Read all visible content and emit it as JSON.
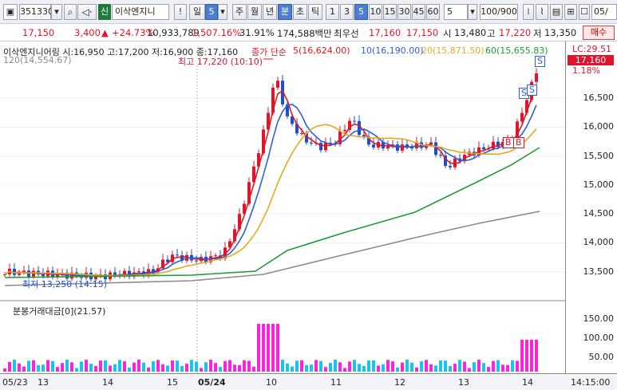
{
  "toolbar": {
    "code": "351330",
    "tag": "신",
    "name": "이삭엔지니",
    "mark": "!",
    "unit_value": "5",
    "period_buttons": [
      "주",
      "월",
      "년",
      "분",
      "초",
      "틱"
    ],
    "interval_buttons": [
      "1",
      "3",
      "5",
      "10",
      "15",
      "30",
      "45",
      "60"
    ],
    "count_value": "5",
    "page": "100/900",
    "date_frag": "05/"
  },
  "quote": {
    "price": "17,150",
    "change": "3,400",
    "change_pct": "+24.73%",
    "volume": "10,933,789",
    "vol_ratio": "1,507.16%",
    "turnover": "31.91%",
    "amount": "174,588백만",
    "best_label": "최우선",
    "best_ask": "17,160",
    "best_bid": "17,150",
    "open_label": "시",
    "open": "13,480",
    "high_label": "고",
    "high": "17,220",
    "low_label": "저",
    "low": "13,350",
    "buy": "매수"
  },
  "legend": {
    "ohlc": "이삭엔지니어링 시:16,950 고:17,200 저:16,900 종:17,160",
    "ma_label": "종가 단순",
    "ma5": "5(16,624.00)",
    "ma10": "10(16,190.00)",
    "ma20": "20(15,871.50)",
    "ma60": "60(15,655.83)",
    "ma120": "120(14,554.67)",
    "high_note": "최고 17,220 (10:10)",
    "low_note": "최저 13,250 (14:15)",
    "lc": "LC:29.51",
    "price_tag": "17,160",
    "pct_tag": "1.18%",
    "vol_title": "분봉거래대금[0](21.57)"
  },
  "colors": {
    "ma5": "#e8141c",
    "ma10": "#2b5fd9",
    "ma20": "#e6a820",
    "ma60": "#1e9b35",
    "ma120": "#8a8a8a",
    "up": "#e0152b",
    "down": "#1a4fd0",
    "vol_up": "#ff22dd",
    "vol_down": "#18c4e8"
  },
  "y_axis": [
    "16,500",
    "16,000",
    "15,500",
    "15,000",
    "14,500",
    "14,000",
    "13,500"
  ],
  "vol_axis": [
    "150.00",
    "100.00",
    "50.00"
  ],
  "x_axis": [
    "05/23",
    "13",
    "14",
    "15",
    "05/24",
    "10",
    "11",
    "12",
    "13",
    "14",
    "14:15:00"
  ]
}
